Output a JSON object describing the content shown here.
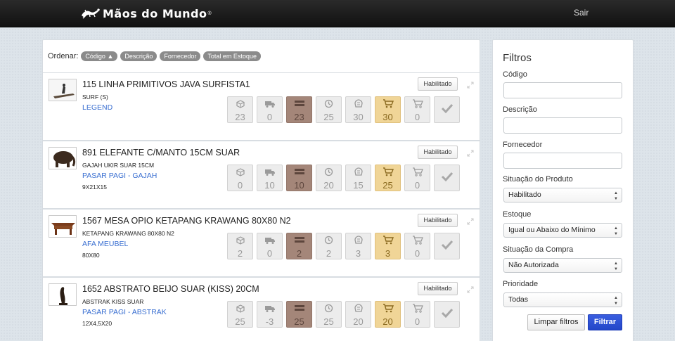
{
  "header": {
    "logo_text": "Mãos do Mundo",
    "logo_mark": "®",
    "logout_label": "Sair"
  },
  "sort": {
    "label": "Ordenar:",
    "options": [
      "Código ▲",
      "Descrição",
      "Fornecedor",
      "Total em Estoque"
    ]
  },
  "products": [
    {
      "name": "115 LINHA PRIMITIVOS JAVA SURFISTA1",
      "desc": "SURF (S)",
      "supplier": "LEGEND",
      "dims": "",
      "status": "Habilitado",
      "stats": [
        "23",
        "0",
        "23",
        "25",
        "30",
        "30",
        "0"
      ]
    },
    {
      "name": "891 ELEFANTE C/MANTO 15CM SUAR",
      "desc": "GAJAH UKIR SUAR 15CM",
      "supplier": "PASAR PAGI - GAJAH",
      "dims": "9X21X15",
      "status": "Habilitado",
      "stats": [
        "0",
        "10",
        "10",
        "20",
        "15",
        "25",
        "0"
      ]
    },
    {
      "name": "1567 MESA OPIO KETAPANG KRAWANG 80X80 N2",
      "desc": "KETAPANG KRAWANG 80X80 N2",
      "supplier": "AFA MEUBEL",
      "dims": "80X80",
      "status": "Habilitado",
      "stats": [
        "2",
        "0",
        "2",
        "2",
        "3",
        "3",
        "0"
      ]
    },
    {
      "name": "1652 ABSTRATO BEIJO SUAR (KISS) 20CM",
      "desc": "ABSTRAK KISS SUAR",
      "supplier": "PASAR PAGI - ABSTRAK",
      "dims": "12X4,5X20",
      "status": "Habilitado",
      "stats": [
        "25",
        "-3",
        "25",
        "25",
        "20",
        "20",
        "0"
      ]
    }
  ],
  "stat_icons": [
    "box-icon",
    "truck-icon",
    "stock-icon",
    "history-icon",
    "sales-icon",
    "cart-icon",
    "cart-outline-icon",
    "check-icon"
  ],
  "filters": {
    "title": "Filtros",
    "codigo_label": "Código",
    "codigo_value": "",
    "descricao_label": "Descrição",
    "descricao_value": "",
    "fornecedor_label": "Fornecedor",
    "fornecedor_value": "",
    "situacao_label": "Situação do Produto",
    "situacao_value": "Habilitado",
    "estoque_label": "Estoque",
    "estoque_value": "Igual ou Abaixo do Mínimo",
    "compra_label": "Situação da Compra",
    "compra_value": "Não Autorizada",
    "prioridade_label": "Prioridade",
    "prioridade_value": "Todas",
    "clear_label": "Limpar filtros",
    "filter_label": "Filtrar"
  },
  "colors": {
    "accent": "#2346c8",
    "link": "#3a6fd1",
    "stock_brown": "#a48679",
    "cart_yellow": "#f0d597"
  }
}
